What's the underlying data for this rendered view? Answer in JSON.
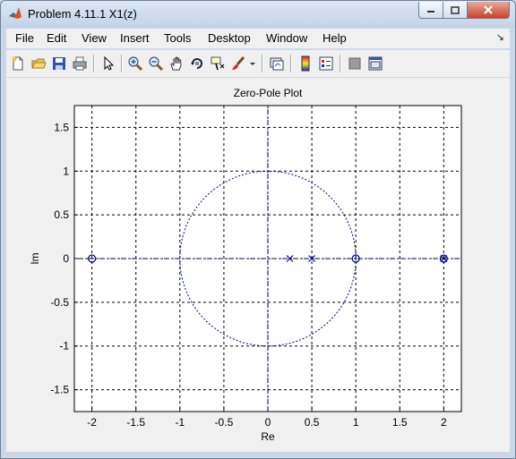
{
  "window": {
    "title": "Problem 4.11.1  X1(z)",
    "controls": [
      "minimize-icon",
      "maximize-icon",
      "close-icon"
    ]
  },
  "menu": {
    "items": [
      "File",
      "Edit",
      "View",
      "Insert",
      "Tools",
      "Desktop",
      "Window",
      "Help"
    ],
    "corner_icon": "dock-arrow-icon"
  },
  "toolbar": {
    "icons": [
      "new-figure-icon",
      "open-file-icon",
      "save-icon",
      "print-icon",
      "pointer-icon",
      "zoom-in-icon",
      "zoom-out-icon",
      "pan-hand-icon",
      "rotate-3d-icon",
      "data-cursor-icon",
      "brush-icon",
      "brush-dropdown-icon",
      "link-plot-icon",
      "colorbar-icon",
      "legend-icon",
      "hide-plot-tools-icon",
      "show-plot-tools-icon"
    ]
  },
  "colors": {
    "accent": "#00008b",
    "grid": "#000000",
    "figure_bg": "#f0f0f0",
    "axes_bg": "#ffffff"
  },
  "chart_data": {
    "type": "scatter",
    "title": "Zero-Pole Plot",
    "xlabel": "Re",
    "ylabel": "Im",
    "xlim": [
      -2.2,
      2.2
    ],
    "ylim": [
      -1.75,
      1.75
    ],
    "xticks": [
      -2,
      -1.5,
      -1,
      -0.5,
      0,
      0.5,
      1,
      1.5,
      2
    ],
    "yticks": [
      -1.5,
      -1,
      -0.5,
      0,
      0.5,
      1,
      1.5
    ],
    "xtick_labels": [
      "-2",
      "-1.5",
      "-1",
      "-0.5",
      "0",
      "0.5",
      "1",
      "1.5",
      "2"
    ],
    "ytick_labels": [
      "-1.5",
      "-1",
      "-0.5",
      "0",
      "0.5",
      "1",
      "1.5"
    ],
    "grid": true,
    "unit_circle": true,
    "zeros": [
      {
        "re": -2,
        "im": 0
      },
      {
        "re": 1,
        "im": 0
      },
      {
        "re": 2,
        "im": 0
      }
    ],
    "poles": [
      {
        "re": 0.25,
        "im": 0
      },
      {
        "re": 0.5,
        "im": 0
      },
      {
        "re": 2,
        "im": 0
      }
    ]
  }
}
